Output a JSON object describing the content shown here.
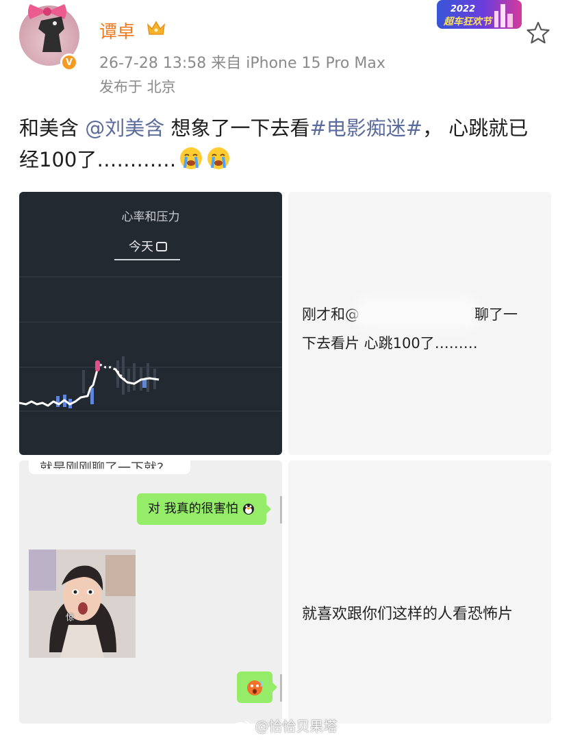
{
  "user": {
    "name": "谭卓",
    "meta": "26-7-28 13:58  来自 iPhone 15 Pro Max",
    "location": "发布于 北京",
    "verified_mark": "V"
  },
  "badge": {
    "year": "2022",
    "text": "超车狂欢节"
  },
  "post": {
    "text_before": "和美含 ",
    "mention": "@刘美含",
    "text_mid": " 想象了一下去看",
    "topic": "#电影痴迷#",
    "text_after": "， 心跳就已经100了…………"
  },
  "images": {
    "heart": {
      "title": "心率和压力",
      "tab": "今天"
    },
    "note1": {
      "line1_prefix": "刚才和@",
      "line1_suffix": "聊了一",
      "line2": "下去看片 心跳100了………"
    },
    "chat": {
      "cut_text": "就是刚刚聊了一下就?",
      "reply": "对 我真的很害怕",
      "sticker_caption": "惊"
    },
    "note2": {
      "text": "就喜欢跟你们这样的人看恐怖片"
    }
  },
  "watermark": "@恰恰贝果塔",
  "icons": [
    "crown-icon",
    "star-icon",
    "verified-icon",
    "calendar-icon",
    "crying-emoji-icon"
  ]
}
